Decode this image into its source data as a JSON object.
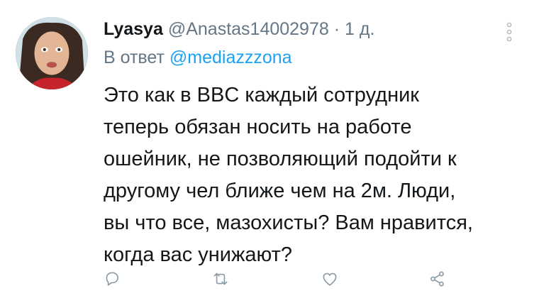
{
  "tweet": {
    "author": {
      "display_name": "Lyasya",
      "handle": "@Anastas14002978",
      "separator": "·",
      "time": "1 д."
    },
    "reply_to": {
      "prefix": "В ответ",
      "mention": "@mediazzzona"
    },
    "text_lines": [
      "Это как в BBC каждый сотрудник",
      "теперь обязан носить на работе",
      "ошейник, не позволяющий подойти к",
      "другому чел ближе чем на 2м. Люди,",
      "вы что все, мазохисты? Вам нравится,",
      "когда вас унижают?"
    ]
  },
  "actions": {
    "reply_icon": "speech-bubble-icon",
    "retweet_icon": "retweet-icon",
    "like_icon": "heart-icon",
    "share_icon": "share-icon"
  },
  "colors": {
    "text": "#14171a",
    "secondary": "#657786",
    "link": "#1da1f2",
    "background": "#ffffff"
  }
}
